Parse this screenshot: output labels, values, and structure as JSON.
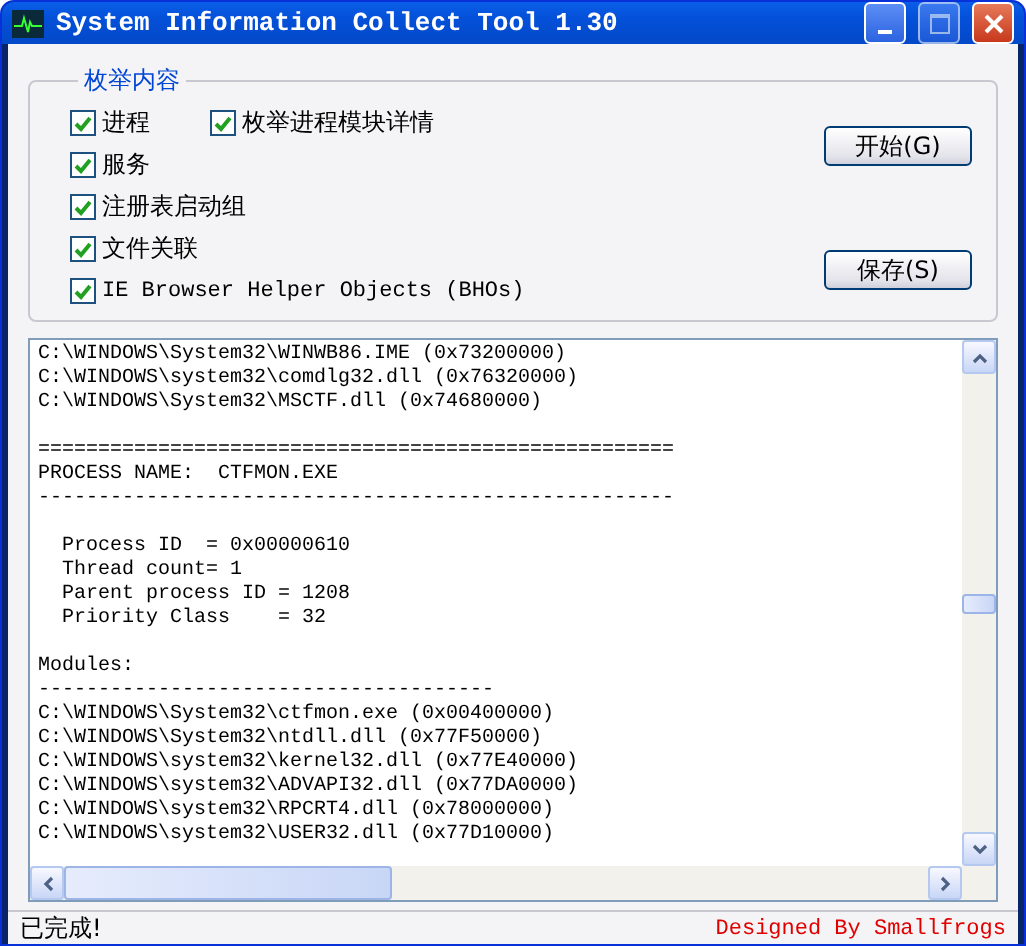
{
  "window": {
    "title": "System Information Collect Tool 1.30"
  },
  "group": {
    "legend": "枚举内容",
    "options": [
      {
        "label": "进程",
        "checked": true
      },
      {
        "label": "枚举进程模块详情",
        "checked": true
      },
      {
        "label": "服务",
        "checked": true
      },
      {
        "label": "注册表启动组",
        "checked": true
      },
      {
        "label": "文件关联",
        "checked": true
      },
      {
        "label": "IE Browser Helper Objects (BHOs)",
        "checked": true
      }
    ],
    "buttons": [
      "开始(G)",
      "保存(S)"
    ]
  },
  "log": {
    "sections": [
      [
        "C:\\WINDOWS\\System32\\WINWB86.IME (0x73200000)",
        "C:\\WINDOWS\\system32\\comdlg32.dll (0x76320000)",
        "C:\\WINDOWS\\System32\\MSCTF.dll (0x74680000)"
      ],
      [
        "=====================================================",
        "PROCESS NAME:  CTFMON.EXE",
        "-----------------------------------------------------"
      ],
      [
        "  Process ID  = 0x00000610",
        "  Thread count= 1",
        "  Parent process ID = 1208",
        "  Priority Class    = 32"
      ],
      [
        "Modules:",
        "--------------------------------------",
        "C:\\WINDOWS\\System32\\ctfmon.exe (0x00400000)",
        "C:\\WINDOWS\\System32\\ntdll.dll (0x77F50000)",
        "C:\\WINDOWS\\system32\\kernel32.dll (0x77E40000)",
        "C:\\WINDOWS\\system32\\ADVAPI32.dll (0x77DA0000)",
        "C:\\WINDOWS\\system32\\RPCRT4.dll (0x78000000)",
        "C:\\WINDOWS\\system32\\USER32.dll (0x77D10000)"
      ]
    ]
  },
  "status_bar": {
    "status": "已完成!",
    "credit": "Designed By Smallfrogs"
  }
}
